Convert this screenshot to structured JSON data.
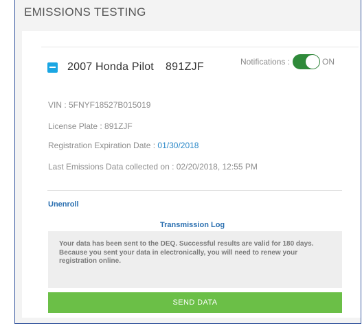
{
  "header": {
    "title": "EMISSIONS TESTING"
  },
  "vehicle": {
    "title": "2007 Honda Pilot",
    "plate_display": "891ZJF",
    "vin": "VIN : 5FNYF18527B015019",
    "license_plate": "License Plate : 891ZJF",
    "registration_label": "Registration Expiration Date : ",
    "registration_date": "01/30/2018",
    "last_emissions": "Last Emissions Data collected on : 02/20/2018, 12:55 PM"
  },
  "notifications": {
    "label": "Notifications :",
    "state": "ON",
    "enabled": true
  },
  "actions": {
    "unenroll": "Unenroll",
    "send_data": "SEND DATA"
  },
  "transmission_log": {
    "title": "Transmission Log",
    "message": "Your data has been sent to the DEQ. Successful results are valid for 180 days. Because you sent your data in electronically, you will need to renew your registration online."
  },
  "colors": {
    "accent_blue": "#1aa6e3",
    "link_blue": "#2a88c8",
    "toggle_green": "#2f8a3a",
    "button_green": "#6bbf47"
  }
}
